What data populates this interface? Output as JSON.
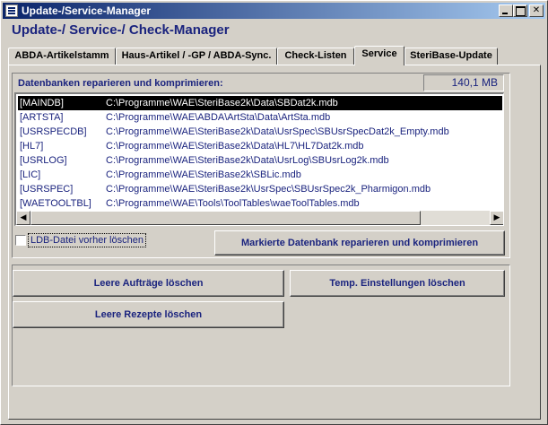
{
  "window": {
    "title": "Update-/Service-Manager",
    "heading": "Update-/ Service-/ Check-Manager"
  },
  "tabs": [
    {
      "label": "ABDA-Artikelstamm",
      "active": false
    },
    {
      "label": "Haus-Artikel / -GP / ABDA-Sync.",
      "active": false
    },
    {
      "label": "Check-Listen",
      "active": false
    },
    {
      "label": "Service",
      "active": true
    },
    {
      "label": "SteriBase-Update",
      "active": false
    }
  ],
  "service": {
    "section_label": "Datenbanken reparieren und komprimieren:",
    "size_display": "140,1 MB",
    "databases": [
      {
        "key": "[MAINDB]",
        "path": "C:\\Programme\\WAE\\SteriBase2k\\Data\\SBDat2k.mdb",
        "selected": true
      },
      {
        "key": "[ARTSTA]",
        "path": "C:\\Programme\\WAE\\ABDA\\ArtSta\\Data\\ArtSta.mdb",
        "selected": false
      },
      {
        "key": "[USRSPECDB]",
        "path": "C:\\Programme\\WAE\\SteriBase2k\\Data\\UsrSpec\\SBUsrSpecDat2k_Empty.mdb",
        "selected": false
      },
      {
        "key": "[HL7]",
        "path": "C:\\Programme\\WAE\\SteriBase2k\\Data\\HL7\\HL7Dat2k.mdb",
        "selected": false
      },
      {
        "key": "[USRLOG]",
        "path": "C:\\Programme\\WAE\\SteriBase2k\\Data\\UsrLog\\SBUsrLog2k.mdb",
        "selected": false
      },
      {
        "key": "[LIC]",
        "path": "C:\\Programme\\WAE\\SteriBase2k\\SBLic.mdb",
        "selected": false
      },
      {
        "key": "[USRSPEC]",
        "path": "C:\\Programme\\WAE\\SteriBase2k\\UsrSpec\\SBUsrSpec2k_Pharmigon.mdb",
        "selected": false
      },
      {
        "key": "[WAETOOLTBL]",
        "path": "C:\\Programme\\WAE\\Tools\\ToolTables\\waeToolTables.mdb",
        "selected": false
      }
    ],
    "ldb_checkbox_label": "LDB-Datei vorher löschen",
    "ldb_checked": false,
    "repair_button": "Markierte Datenbank reparieren und komprimieren",
    "clear_orders_button": "Leere Aufträge löschen",
    "clear_temp_button": "Temp. Einstellungen löschen",
    "clear_recipes_button": "Leere Rezepte löschen"
  }
}
